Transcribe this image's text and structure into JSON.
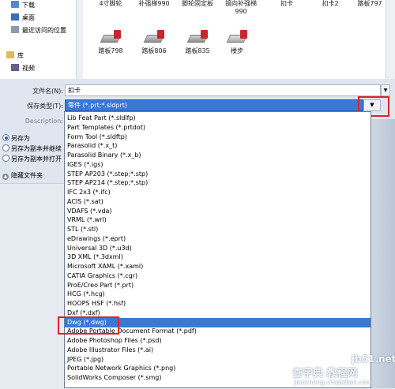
{
  "nav": {
    "items": [
      {
        "label": "下载"
      },
      {
        "label": "桌面"
      },
      {
        "label": "最近访问的位置"
      },
      {
        "label": "库"
      },
      {
        "label": "视频"
      }
    ]
  },
  "files": [
    {
      "name": "4寸脚轮",
      "name2": ""
    },
    {
      "name": "补强梯990",
      "name2": ""
    },
    {
      "name": "脚轮固定板",
      "name2": ""
    },
    {
      "name": "镜向补强梯",
      "name2": "990"
    },
    {
      "name": "扣卡",
      "name2": ""
    },
    {
      "name": "扣卡2",
      "name2": ""
    },
    {
      "name": "踏板797",
      "name2": ""
    },
    {
      "name": "踏板798",
      "name2": ""
    },
    {
      "name": "踏板806",
      "name2": ""
    },
    {
      "name": "踏板835",
      "name2": ""
    },
    {
      "name": "楼步",
      "name2": ""
    }
  ],
  "form": {
    "filename_label": "文件名(N):",
    "filename_value": "扣卡",
    "filetype_label": "保存类型(T):",
    "filetype_value": "零件 (*.prt;*.sldprt)",
    "description_label": "Description:"
  },
  "options": {
    "save_as": "另存为",
    "save_copy_continue": "另存为副本并继续",
    "save_copy_open": "另存为副本并打开",
    "hide_folders": "隐藏文件夹",
    "selected": "save_as"
  },
  "file_types": [
    "Lib Feat Part (*.sldlfp)",
    "Part Templates (*.prtdot)",
    "Form Tool (*.sldftp)",
    "Parasolid (*.x_t)",
    "Parasolid Binary (*.x_b)",
    "IGES (*.igs)",
    "STEP AP203 (*.step;*.stp)",
    "STEP AP214 (*.step;*.stp)",
    "IFC 2x3 (*.ifc)",
    "ACIS (*.sat)",
    "VDAFS (*.vda)",
    "VRML (*.wrl)",
    "STL (*.stl)",
    "eDrawings (*.eprt)",
    "Universal 3D (*.u3d)",
    "3D XML (*.3dxml)",
    "Microsoft XAML (*.xaml)",
    "CATIA Graphics (*.cgr)",
    "ProE/Creo Part (*.prt)",
    "HCG (*.hcg)",
    "HOOPS HSF (*.hsf)",
    "Dxf (*.dxf)",
    "Dwg (*.dwg)",
    "Adobe Portable Document Format (*.pdf)",
    "Adobe Photoshop Files (*.psd)",
    "Adobe Illustrator Files (*.ai)",
    "JPEG (*.jpg)",
    "Portable Network Graphics (*.png)",
    "SolidWorks Composer (*.smg)"
  ],
  "selected_type_index": 22,
  "watermark": {
    "line1": "jb51.net",
    "line2": "查字典 教程网",
    "line3": "jiaocheng.chazidian.com"
  },
  "colors": {
    "highlight": "#3a78d8",
    "annotation": "#e0232b"
  }
}
